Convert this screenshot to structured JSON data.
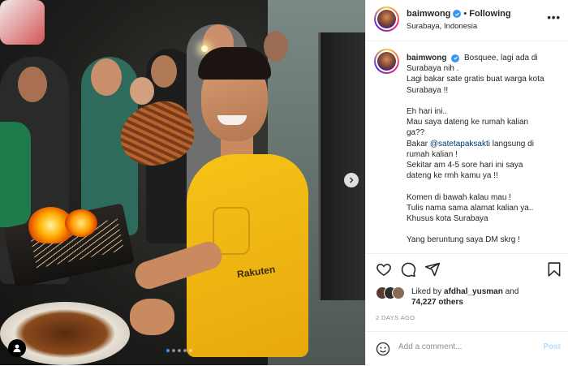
{
  "post": {
    "username": "baimwong",
    "follow_status": "Following",
    "separator": "•",
    "location": "Surabaya, Indonesia",
    "more_icon": "more-icon"
  },
  "caption": {
    "username": "baimwong",
    "line1": "Bosquee, lagi ada di",
    "line2": "Surabaya nih .",
    "line3": "Lagi bakar sate gratis buat warga kota",
    "line4": "Surabaya !!",
    "para2_line1": "Eh hari ini..",
    "para2_line2": "Mau saya dateng ke rumah kalian",
    "para2_line3": "ga??",
    "para2_line4_prefix": "Bakar",
    "para2_mention": "@satetapaksakti",
    "para2_line4_suffix": "langsung di",
    "para2_line5": "rumah kalian !",
    "para2_line6": "Sekitar am 4-5 sore hari ini saya",
    "para2_line7": "dateng ke rmh kamu ya !!",
    "para3_line1": "Komen di bawah kalau mau !",
    "para3_line2": "Tulis nama sama alamat kalian ya..",
    "para3_line3": "Khusus kota Surabaya",
    "para4_line1": "Yang beruntung saya DM skrg !"
  },
  "likes": {
    "prefix": "Liked by",
    "user": "afdhal_yusman",
    "middle": "and",
    "count": "74,227 others"
  },
  "time_ago": "2 DAYS AGO",
  "comment": {
    "placeholder": "Add a comment...",
    "post_label": "Post"
  },
  "photo": {
    "shirt_brand": "Rakuten",
    "carousel_total": 5,
    "carousel_active": 1
  },
  "colors": {
    "verified": "#3897f0",
    "link": "#00376b",
    "post_disabled": "#b2dffc",
    "muted": "#8e8e8e"
  }
}
